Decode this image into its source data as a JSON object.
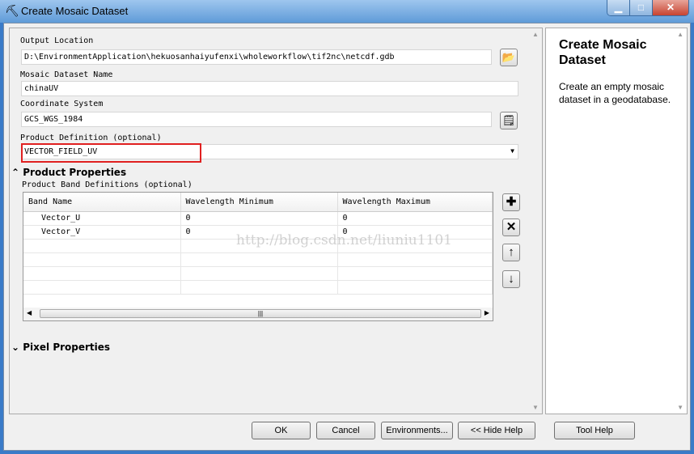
{
  "window": {
    "title": "Create Mosaic Dataset",
    "minimize": "▁",
    "maximize": "□",
    "close": "✕"
  },
  "form": {
    "output_location": {
      "label": "Output Location",
      "value": "D:\\EnvironmentApplication\\hekuosanhaiyufenxi\\wholeworkflow\\tif2nc\\netcdf.gdb"
    },
    "dataset_name": {
      "label": "Mosaic Dataset Name",
      "value": "chinaUV"
    },
    "coordinate_system": {
      "label": "Coordinate System",
      "value": "GCS_WGS_1984"
    },
    "product_definition": {
      "label": "Product Definition (optional)",
      "value": "VECTOR_FIELD_UV"
    },
    "product_properties": {
      "label": "Product Properties",
      "sublabel": "Product Band Definitions (optional)",
      "columns": [
        "Band Name",
        "Wavelength Minimum",
        "Wavelength Maximum"
      ],
      "rows": [
        [
          "Vector_U",
          "0",
          "0"
        ],
        [
          "Vector_V",
          "0",
          "0"
        ]
      ]
    },
    "pixel_properties": {
      "label": "Pixel Properties"
    }
  },
  "watermark": "http://blog.csdn.net/liuniu1101",
  "help": {
    "title": "Create Mosaic Dataset",
    "text": "Create an empty mosaic dataset in a geodatabase."
  },
  "buttons": {
    "ok": "OK",
    "cancel": "Cancel",
    "environments": "Environments...",
    "hide_help": "<< Hide Help",
    "tool_help": "Tool Help"
  }
}
